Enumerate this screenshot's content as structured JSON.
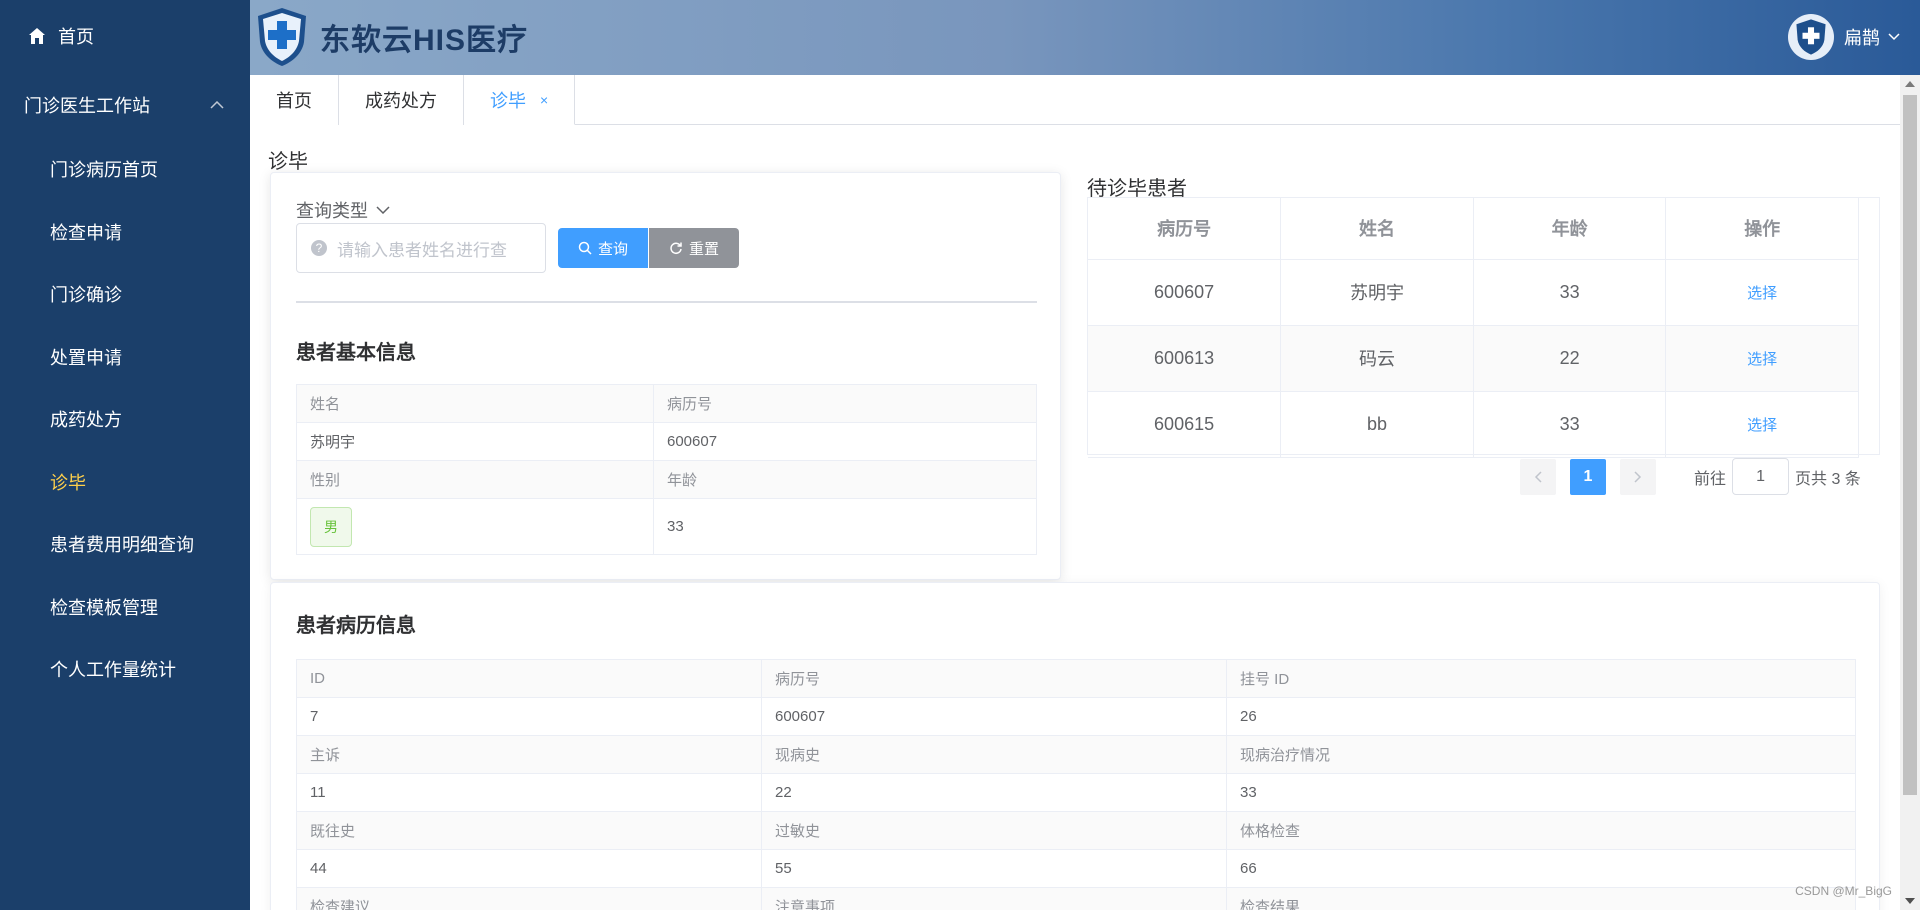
{
  "sidebar": {
    "home": "首页",
    "group": "门诊医生工作站",
    "items": [
      "门诊病历首页",
      "检查申请",
      "门诊确诊",
      "处置申请",
      "成药处方",
      "诊毕",
      "患者费用明细查询",
      "检查模板管理",
      "个人工作量统计"
    ],
    "active": "诊毕"
  },
  "header": {
    "title": "东软云HIS医疗",
    "user": "扁鹊"
  },
  "tabs": [
    {
      "label": "首页"
    },
    {
      "label": "成药处方"
    },
    {
      "label": "诊毕",
      "close": "×"
    }
  ],
  "page_title": "诊毕",
  "query": {
    "type_label": "查询类型",
    "placeholder": "请输入患者姓名进行查",
    "search_btn": "查询",
    "reset_btn": "重置"
  },
  "patient_basic": {
    "title": "患者基本信息",
    "name_label": "姓名",
    "record_label": "病历号",
    "name": "苏明宇",
    "record_no": "600607",
    "gender_label": "性别",
    "age_label": "年龄",
    "gender": "男",
    "age": "33"
  },
  "waiting": {
    "title": "待诊毕患者",
    "columns": [
      "病历号",
      "姓名",
      "年龄",
      "操作"
    ],
    "rows": [
      {
        "record": "600607",
        "name": "苏明宇",
        "age": "33",
        "action": "选择"
      },
      {
        "record": "600613",
        "name": "码云",
        "age": "22",
        "action": "选择"
      },
      {
        "record": "600615",
        "name": "bb",
        "age": "33",
        "action": "选择"
      }
    ]
  },
  "pagination": {
    "current": "1",
    "goto_label": "前往",
    "goto_value": "1",
    "total": "页共 3 条"
  },
  "medical_record": {
    "title": "患者病历信息",
    "rows": [
      [
        "ID",
        "病历号",
        "挂号 ID"
      ],
      [
        "7",
        "600607",
        "26"
      ],
      [
        "主诉",
        "现病史",
        "现病治疗情况"
      ],
      [
        "11",
        "22",
        "33"
      ],
      [
        "既往史",
        "过敏史",
        "体格检查"
      ],
      [
        "44",
        "55",
        "66"
      ],
      [
        "检查建议",
        "注意事项",
        "检查结果"
      ]
    ]
  },
  "watermark": "CSDN @Mr_BigG",
  "colors": {
    "sidebar": "#1b3f6a",
    "active": "#ffd04b",
    "primary": "#409eff"
  }
}
